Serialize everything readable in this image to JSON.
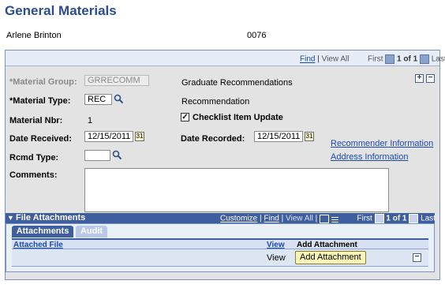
{
  "page": {
    "title": "General Materials"
  },
  "header": {
    "name": "Arlene Brinton",
    "id": "0076"
  },
  "panel": {
    "find": "Find",
    "view_all": "View All",
    "first": "First",
    "range": "1 of 1",
    "last": "Last",
    "add_symbol": "+",
    "remove_symbol": "−"
  },
  "form": {
    "material_group": {
      "label": "*Material Group:",
      "value": "GRRECOMM",
      "desc": "Graduate Recommendations"
    },
    "material_type": {
      "label": "*Material Type:",
      "value": "REC",
      "desc": "Recommendation"
    },
    "material_nbr": {
      "label": "Material Nbr:",
      "value": "1"
    },
    "checklist": {
      "label": "Checklist Item Update",
      "checked": true
    },
    "date_received": {
      "label": "Date Received:",
      "value": "12/15/2011"
    },
    "date_recorded": {
      "label": "Date Recorded:",
      "value": "12/15/2011"
    },
    "rcmd_type": {
      "label": "Rcmd Type:",
      "value": ""
    },
    "comments": {
      "label": "Comments:",
      "value": ""
    },
    "links": {
      "recommender": "Recommender Information",
      "address": "Address Information"
    }
  },
  "attachments": {
    "title": "File Attachments",
    "customize": "Customize",
    "find": "Find",
    "view_all": "View All",
    "first": "First",
    "range": "1 of 1",
    "last": "Last",
    "tabs": [
      {
        "label": "Attachments",
        "active": true
      },
      {
        "label": "Audit",
        "active": false
      }
    ],
    "columns": {
      "attached_file": "Attached File",
      "view": "View",
      "add_attachment": "Add Attachment"
    },
    "rows": [
      {
        "attached_file": "",
        "view": "View",
        "add_button": "Add Attachment"
      }
    ]
  }
}
